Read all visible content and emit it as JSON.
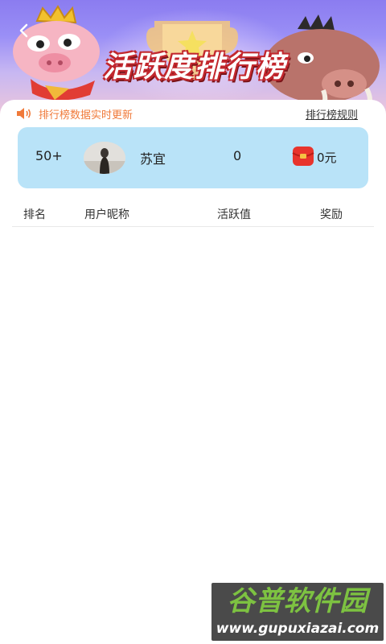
{
  "banner": {
    "title": "活跃度排行榜",
    "back_icon": "chevron-left-icon"
  },
  "notice": {
    "icon": "speaker-icon",
    "text": "排行榜数据实时更新",
    "rules_link": "排行榜规则",
    "color": "#f07a3a"
  },
  "my_entry": {
    "rank": "50+",
    "name": "苏宜",
    "score": "0",
    "reward": "0元",
    "card_color": "#b9e3f8"
  },
  "table": {
    "headers": [
      "排名",
      "用户昵称",
      "活跃值",
      "奖励"
    ],
    "rows": []
  },
  "watermark": {
    "main": "谷普软件园",
    "sub": "www.gupuxiazai.com"
  }
}
